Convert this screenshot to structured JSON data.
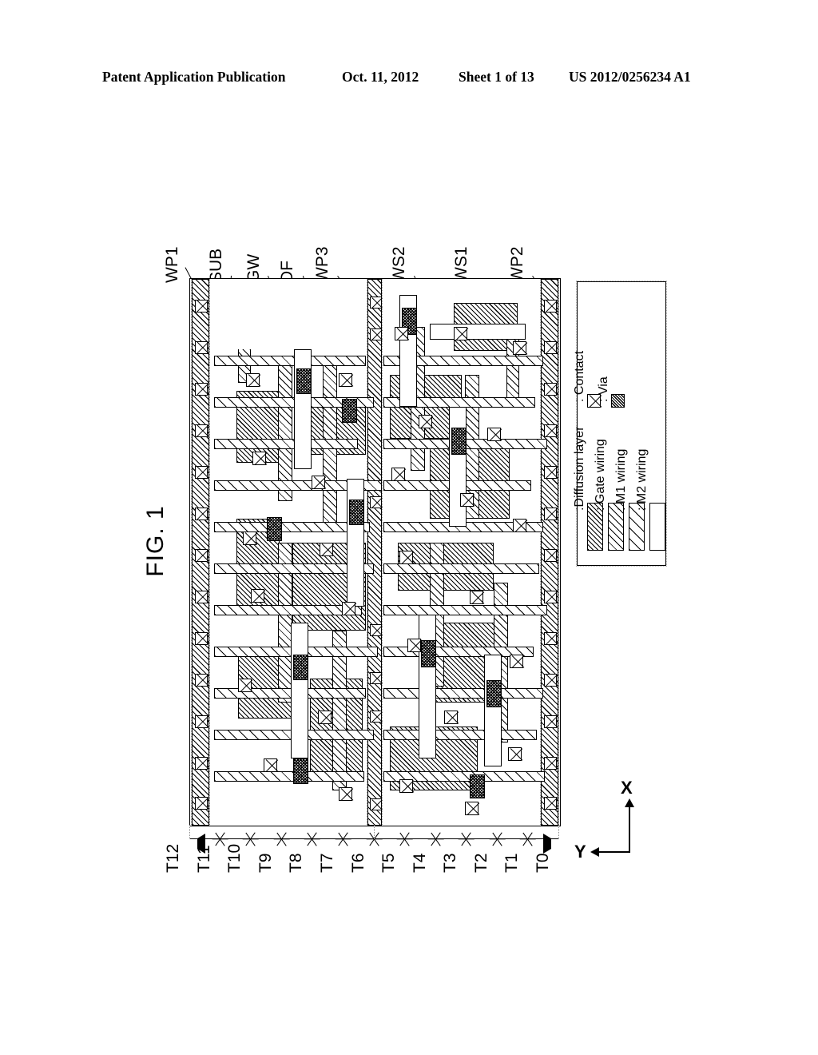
{
  "header": {
    "publication": "Patent Application Publication",
    "date": "Oct. 11, 2012",
    "sheet": "Sheet 1 of 13",
    "number": "US 2012/0256234 A1"
  },
  "figure": {
    "title": "FIG. 1",
    "callouts": [
      {
        "id": "WP1",
        "label": "WP1"
      },
      {
        "id": "SUB",
        "label": "SUB"
      },
      {
        "id": "GW",
        "label": "GW"
      },
      {
        "id": "DF",
        "label": "DF"
      },
      {
        "id": "WP3",
        "label": "WP3"
      },
      {
        "id": "WS2",
        "label": "WS2"
      },
      {
        "id": "WS1",
        "label": "WS1"
      },
      {
        "id": "WP2",
        "label": "WP2"
      }
    ]
  },
  "legend": {
    "patterns": [
      {
        "key": "diffusion",
        "label": ":Diffusion layer"
      },
      {
        "key": "gate",
        "label": ": Gate wiring"
      },
      {
        "key": "m1",
        "label": ": M1 wiring"
      },
      {
        "key": "m2",
        "label": ": M2 wiring"
      }
    ],
    "markers": [
      {
        "key": "contact",
        "label": ": Contact"
      },
      {
        "key": "via",
        "label": ": Via"
      }
    ]
  },
  "tracks": {
    "labels": [
      "T12",
      "T11",
      "T10",
      "T9",
      "T8",
      "T7",
      "T6",
      "T5",
      "T4",
      "T3",
      "T2",
      "T1",
      "T0"
    ]
  },
  "axes": {
    "x": "X",
    "y": "Y"
  },
  "colors": {
    "ink": "#000000",
    "paper": "#ffffff"
  }
}
